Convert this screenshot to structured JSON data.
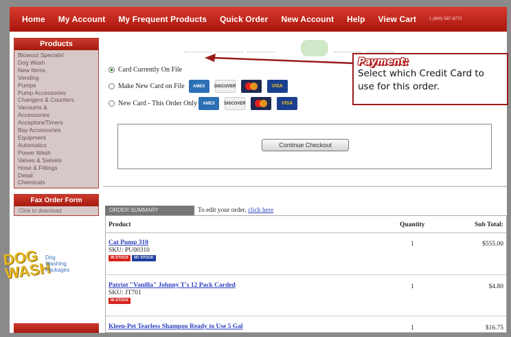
{
  "nav": {
    "items": [
      "Home",
      "My Account",
      "My Frequent Products",
      "Quick Order",
      "New Account",
      "Help",
      "View Cart"
    ],
    "phone": "1 (800) 587-9772"
  },
  "sidebar": {
    "products_title": "Products",
    "products": [
      "Blowout Specials!",
      "Dog Wash",
      "New Items",
      "Vending",
      "Pumps",
      "Pump Accessories",
      "Changers & Counters",
      "Vacuums &",
      "Accessories",
      "Acceptors/Timers",
      "Bay Accessories",
      "Equipment",
      "Automatics",
      "Power Wash",
      "Valves & Swivels",
      "Hose & Fittings",
      "Detail",
      "Chemicals"
    ],
    "fax_title": "Fax Order Form",
    "fax_sub": "Click to download",
    "dogwash_logo": "DOG WASH",
    "dogwash_text": [
      "Dog",
      "Washing",
      "Packages"
    ]
  },
  "payment": {
    "options": [
      "Card Currently On File",
      "Make New Card on File",
      "New Card - This Order Only"
    ],
    "selected": 0,
    "cards": [
      "AMEX",
      "DISCOVER",
      "MasterCard",
      "VISA"
    ]
  },
  "callout": {
    "title": "Payment:",
    "text": "Select which Credit Card to use for this order."
  },
  "continue_label": "Continue Checkout",
  "order_summary": {
    "tab": "ORDER SUMMARY",
    "edit_text": "To edit your order,",
    "edit_link": "click here",
    "headers": {
      "product": "Product",
      "quantity": "Quantity",
      "subtotal": "Sub Total:"
    },
    "rows": [
      {
        "name": "Cat Pump 310",
        "sku": "SKU: PU00310",
        "badges": [
          "IN STOCK",
          "NV STOCK"
        ],
        "qty": "1",
        "subtotal": "$555.00"
      },
      {
        "name": "Patriot \"Vanilla\" Johnny T's 12 Pack Carded",
        "sku": "SKU: JT701",
        "badges": [
          "IN STOCK"
        ],
        "qty": "1",
        "subtotal": "$4.80"
      },
      {
        "name": "Kleen-Pet Tearless Shampoo Ready to Use 5 Gal",
        "sku": "",
        "badges": [],
        "qty": "1",
        "subtotal": "$16.75"
      }
    ]
  },
  "colors": {
    "brand_red": "#b91f14",
    "link_blue": "#2a3ec0",
    "callout_red": "#b01818"
  }
}
